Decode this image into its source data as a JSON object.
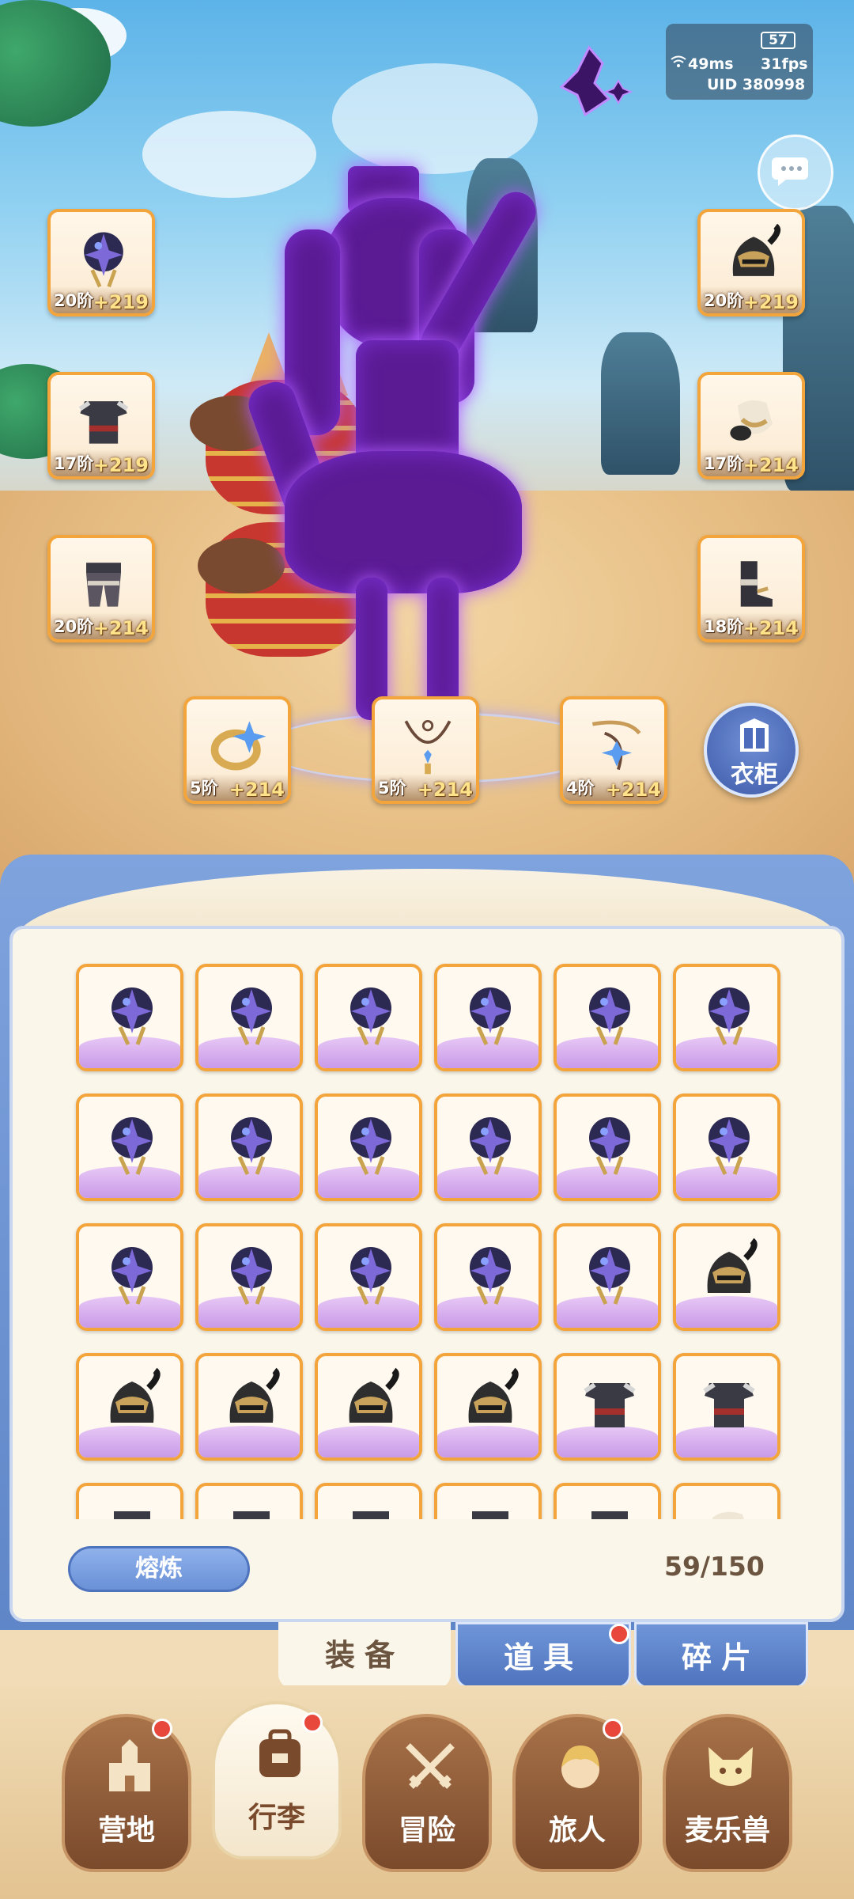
{
  "hud": {
    "battery": "57",
    "ping": "49ms",
    "fps": "31fps",
    "uid": "UID 380998"
  },
  "equipment": {
    "left": [
      {
        "level": "20阶",
        "bonus": "+219",
        "icon": "dark-helmet-orb-icon"
      },
      {
        "level": "17阶",
        "bonus": "+219",
        "icon": "dark-armor-icon"
      },
      {
        "level": "20阶",
        "bonus": "+214",
        "icon": "armor-pants-icon"
      }
    ],
    "right": [
      {
        "level": "20阶",
        "bonus": "+219",
        "icon": "horned-helmet-icon"
      },
      {
        "level": "17阶",
        "bonus": "+214",
        "icon": "gauntlet-icon"
      },
      {
        "level": "18阶",
        "bonus": "+214",
        "icon": "boots-icon"
      }
    ],
    "bottom": [
      {
        "level": "5阶",
        "bonus": "+214",
        "icon": "ring-icon"
      },
      {
        "level": "5阶",
        "bonus": "+214",
        "icon": "necklace-icon"
      },
      {
        "level": "4阶",
        "bonus": "+214",
        "icon": "amulet-icon"
      }
    ]
  },
  "wardrobe_label": "衣柜",
  "inventory": {
    "smelt_label": "熔炼",
    "capacity": "59/150",
    "rows": [
      [
        "orb",
        "orb",
        "orb",
        "orb",
        "orb",
        "orb"
      ],
      [
        "orb",
        "orb",
        "orb",
        "orb",
        "orb",
        "orb"
      ],
      [
        "orb",
        "orb",
        "orb",
        "orb",
        "orb",
        "helmet"
      ],
      [
        "helmet",
        "helmet",
        "helmet",
        "helmet",
        "armor",
        "armor"
      ],
      [
        "pants",
        "pants",
        "pants",
        "pants",
        "pants",
        "gauntlet"
      ]
    ]
  },
  "subtabs": [
    {
      "label": "装备",
      "active": true,
      "badge": false
    },
    {
      "label": "道具",
      "active": false,
      "badge": true
    },
    {
      "label": "碎片",
      "active": false,
      "badge": false
    }
  ],
  "nav": [
    {
      "label": "营地",
      "icon": "castle-icon",
      "active": false,
      "badge": true
    },
    {
      "label": "行李",
      "icon": "backpack-icon",
      "active": true,
      "badge": true
    },
    {
      "label": "冒险",
      "icon": "crossed-swords-icon",
      "active": false,
      "badge": false
    },
    {
      "label": "旅人",
      "icon": "traveler-icon",
      "active": false,
      "badge": true
    },
    {
      "label": "麦乐兽",
      "icon": "cat-pet-icon",
      "active": false,
      "badge": false
    }
  ],
  "colors": {
    "slot_border": "#f3a53c",
    "accent_blue": "#5f86c8",
    "badge_red": "#e8483c",
    "aura_purple": "#b15cff"
  }
}
